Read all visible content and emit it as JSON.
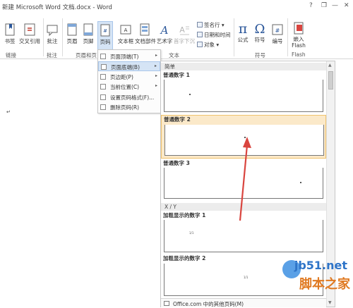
{
  "window": {
    "title": "新建 Microsoft Word 文档.docx - Word",
    "help": "?",
    "minimize": "—",
    "restore": "❐",
    "close": "✕"
  },
  "ribbon": {
    "bookmark": "书签",
    "crossref": "交叉引用",
    "comment": "批注",
    "header": "页眉",
    "footer": "页脚",
    "pagenumber": "页码",
    "textbox": "文本框",
    "quickparts": "文档部件",
    "wordart": "艺术字",
    "dropcap": "首字下沉",
    "signature": "签名行",
    "datetime": "日期和时间",
    "object": "对象",
    "equation": "公式",
    "symbol": "符号",
    "number": "编号",
    "flash": "嵌入 Flash",
    "groups": {
      "links": "链接",
      "comments": "批注",
      "headerfooter": "页眉和页",
      "text": "文本",
      "symbols": "符号",
      "flash": "Flash"
    }
  },
  "menu": {
    "items": [
      {
        "label": "页面顶端(T)",
        "arrow": "▸"
      },
      {
        "label": "页面底端(B)",
        "arrow": "▸"
      },
      {
        "label": "页边距(P)",
        "arrow": "▸"
      },
      {
        "label": "当前位置(C)",
        "arrow": "▸"
      },
      {
        "label": "设置页码格式(F)...",
        "arrow": ""
      },
      {
        "label": "删除页码(R)",
        "arrow": ""
      }
    ]
  },
  "gallery": {
    "section_simple": "简单",
    "item1": "普通数字 1",
    "item2": "普通数字 2",
    "item3": "普通数字 3",
    "section_xy": "X / Y",
    "item4": "加粗显示的数字 1",
    "item5": "加粗显示的数字 2",
    "footer": "Office.com 中的其他页码(M)",
    "mini4": "1/1",
    "mini5": "1/1"
  },
  "document": {
    "mark": "↵"
  },
  "watermark": {
    "site": "jb51.net",
    "brand": "脚本之家"
  },
  "colors": {
    "accent": "#2b579a",
    "arrow": "#d9453f",
    "selected": "#fbe9c9"
  }
}
